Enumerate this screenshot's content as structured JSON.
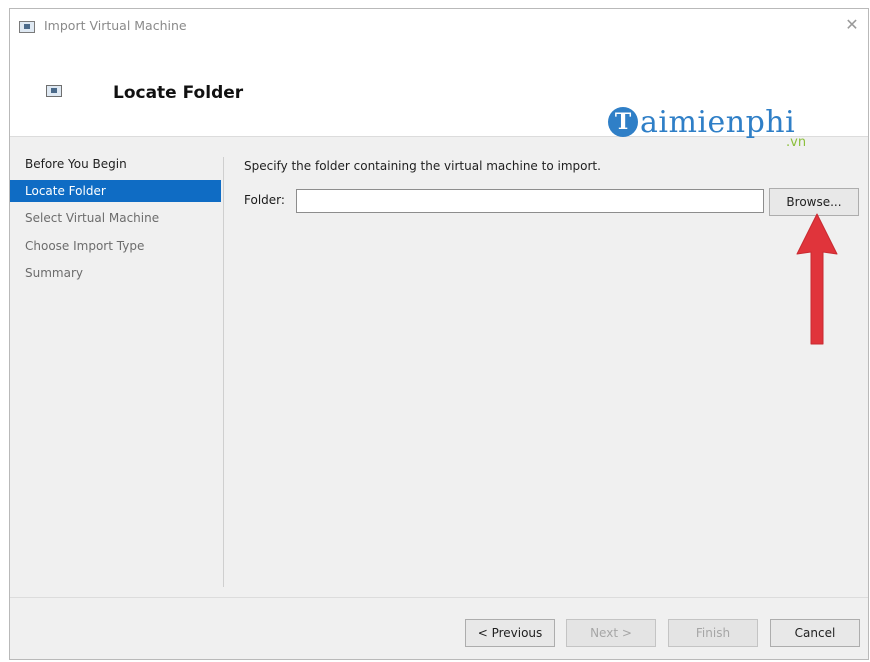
{
  "window": {
    "title": "Import Virtual Machine",
    "close_glyph": "✕"
  },
  "header": {
    "title": "Locate Folder"
  },
  "watermark": {
    "initial": "T",
    "text": "aimienphi",
    "suffix": ".vn"
  },
  "sidebar": {
    "items": [
      {
        "label": "Before You Begin"
      },
      {
        "label": "Locate Folder"
      },
      {
        "label": "Select Virtual Machine"
      },
      {
        "label": "Choose Import Type"
      },
      {
        "label": "Summary"
      }
    ]
  },
  "main": {
    "prompt": "Specify the folder containing the virtual machine to import.",
    "folder_label": "Folder:",
    "folder_value": "",
    "browse_label": "Browse..."
  },
  "footer": {
    "previous_label": "< Previous",
    "next_label": "Next >",
    "finish_label": "Finish",
    "cancel_label": "Cancel"
  },
  "colors": {
    "accent": "#0f6cc4",
    "arrow": "#e0343b",
    "watermark_blue": "#2f7fc7",
    "watermark_green": "#8cbf3c"
  },
  "icons": [
    "window-icon",
    "close-icon",
    "wizard-icon",
    "annotation-arrow-icon"
  ]
}
